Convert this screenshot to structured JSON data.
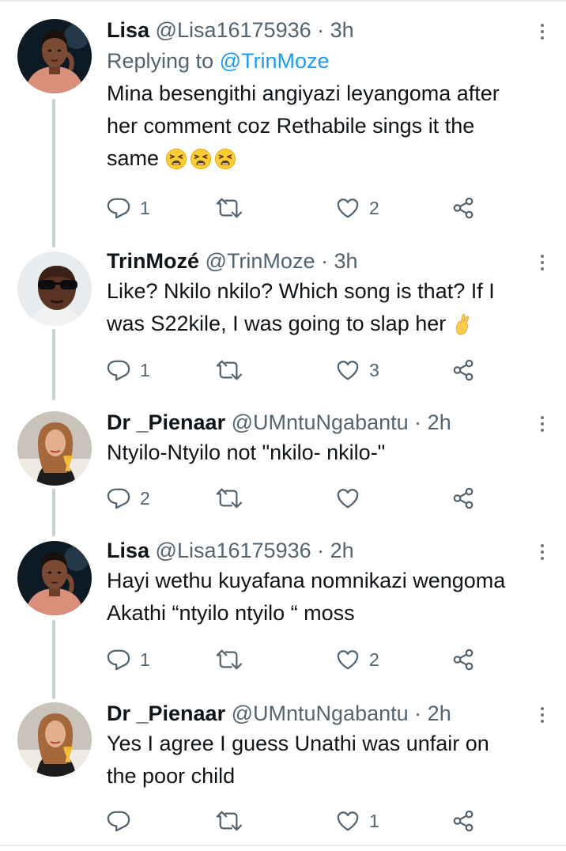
{
  "tweets": [
    {
      "name": "Lisa",
      "handle": "@Lisa16175936",
      "separator": "·",
      "time": "3h",
      "replying_to_prefix": "Replying to ",
      "replying_to_handle": "@TrinMoze",
      "lines": [
        "Mina besengithi angiyazi leyangoma after",
        "her comment coz Rethabile sings it the",
        "same"
      ],
      "emoji": "weary-face",
      "reply_count": "1",
      "retweet_count": "",
      "like_count": "2"
    },
    {
      "name": "TrinMozé",
      "handle": "@TrinMoze",
      "separator": "·",
      "time": "3h",
      "lines": [
        "Like? Nkilo nkilo? Which song is that? If I",
        "was S22kile, I was going to slap her"
      ],
      "emoji": "crossed-fingers",
      "reply_count": "1",
      "retweet_count": "",
      "like_count": "3"
    },
    {
      "name": "Dr _Pienaar",
      "handle": "@UMntuNgabantu",
      "separator": "·",
      "time": "2h",
      "lines": [
        "Ntyilo-Ntyilo not \"nkilo- nkilo-\""
      ],
      "reply_count": "2",
      "retweet_count": "",
      "like_count": ""
    },
    {
      "name": "Lisa",
      "handle": "@Lisa16175936",
      "separator": "·",
      "time": "2h",
      "lines": [
        "Hayi wethu kuyafana nomnikazi wengoma",
        "Akathi “ntyilo ntyilo “ moss"
      ],
      "reply_count": "1",
      "retweet_count": "",
      "like_count": "2"
    },
    {
      "name": "Dr _Pienaar",
      "handle": "@UMntuNgabantu",
      "separator": "·",
      "time": "2h",
      "lines": [
        "Yes I agree I guess Unathi was unfair on",
        "the poor child"
      ],
      "reply_count": "",
      "retweet_count": "",
      "like_count": "1"
    }
  ],
  "colors": {
    "text": "#0f1419",
    "secondary": "#536471",
    "accent": "#1d9bf0",
    "thread_line": "#c4cfd6",
    "divider": "#e6ecf0"
  },
  "icons": {
    "reply": "reply-icon",
    "retweet": "retweet-icon",
    "like": "heart-icon",
    "share": "share-icon",
    "more": "more-icon"
  }
}
